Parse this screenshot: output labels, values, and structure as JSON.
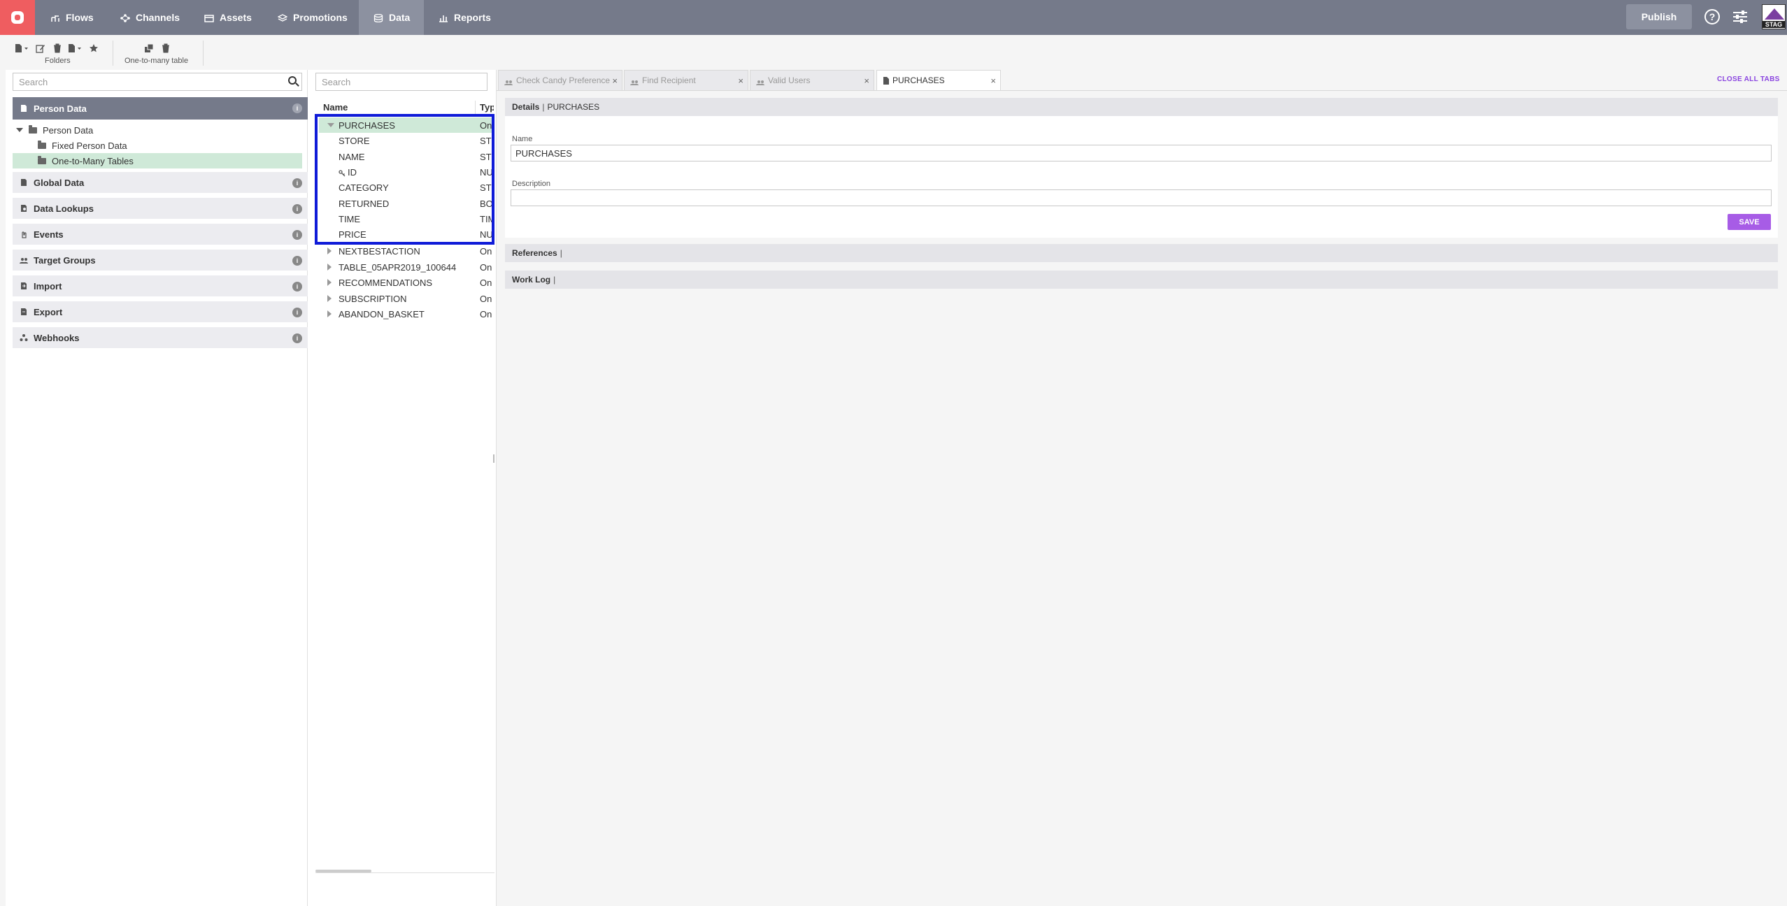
{
  "nav": {
    "items": [
      {
        "label": "Flows",
        "icon": "flows-icon"
      },
      {
        "label": "Channels",
        "icon": "channels-icon"
      },
      {
        "label": "Assets",
        "icon": "assets-icon"
      },
      {
        "label": "Promotions",
        "icon": "promotions-icon"
      },
      {
        "label": "Data",
        "icon": "data-icon",
        "active": true
      },
      {
        "label": "Reports",
        "icon": "reports-icon"
      }
    ],
    "publish_label": "Publish",
    "help_glyph": "?",
    "env_label": "STAG"
  },
  "toolbar": {
    "folders_label": "Folders",
    "one_to_many_label": "One-to-many table"
  },
  "left": {
    "search_placeholder": "Search",
    "categories": [
      {
        "label": "Person Data",
        "active": true
      },
      {
        "label": "Global Data"
      },
      {
        "label": "Data Lookups"
      },
      {
        "label": "Events"
      },
      {
        "label": "Target Groups"
      },
      {
        "label": "Import"
      },
      {
        "label": "Export"
      },
      {
        "label": "Webhooks"
      }
    ],
    "tree": {
      "root": "Person Data",
      "children": [
        "Fixed Person Data",
        "One-to-Many Tables"
      ],
      "selected": "One-to-Many Tables"
    }
  },
  "middle": {
    "search_placeholder": "Search",
    "col_name": "Name",
    "col_type": "Type",
    "expanded_table": {
      "name": "PURCHASES",
      "type": "One-to-many"
    },
    "fields": [
      {
        "name": "STORE",
        "type": "STRING"
      },
      {
        "name": "NAME",
        "type": "STRING"
      },
      {
        "name": "ID",
        "type": "NUMBER",
        "key": true
      },
      {
        "name": "CATEGORY",
        "type": "STRING"
      },
      {
        "name": "RETURNED",
        "type": "BOOLEAN"
      },
      {
        "name": "TIME",
        "type": "TIMESTAMP"
      },
      {
        "name": "PRICE",
        "type": "NUMBER"
      }
    ],
    "tables": [
      {
        "name": "NEXTBESTACTION",
        "type": "One-to-many"
      },
      {
        "name": "TABLE_05APR2019_100644",
        "type": "One-to-many"
      },
      {
        "name": "RECOMMENDATIONS",
        "type": "One-to-many"
      },
      {
        "name": "SUBSCRIPTION",
        "type": "One-to-many"
      },
      {
        "name": "ABANDON_BASKET",
        "type": "One-to-many"
      }
    ]
  },
  "tabs": {
    "items": [
      {
        "label": "Check Candy Preference"
      },
      {
        "label": "Find Recipient"
      },
      {
        "label": "Valid Users"
      },
      {
        "label": "PURCHASES",
        "active": true
      }
    ],
    "close_glyph": "×",
    "close_all_label": "CLOSE ALL TABS"
  },
  "details": {
    "title": "Details",
    "subtitle": "PURCHASES",
    "name_label": "Name",
    "name_value": "PURCHASES",
    "description_label": "Description",
    "description_value": "",
    "save_label": "SAVE"
  },
  "sections": {
    "references": "References",
    "work_log": "Work Log",
    "pipe": "|"
  },
  "colors": {
    "topbar": "#757a8a",
    "logo": "#ef5d60",
    "selected_row": "#cfe9d8",
    "highlight": "#0f1bd8",
    "accent": "#a75ce6"
  }
}
